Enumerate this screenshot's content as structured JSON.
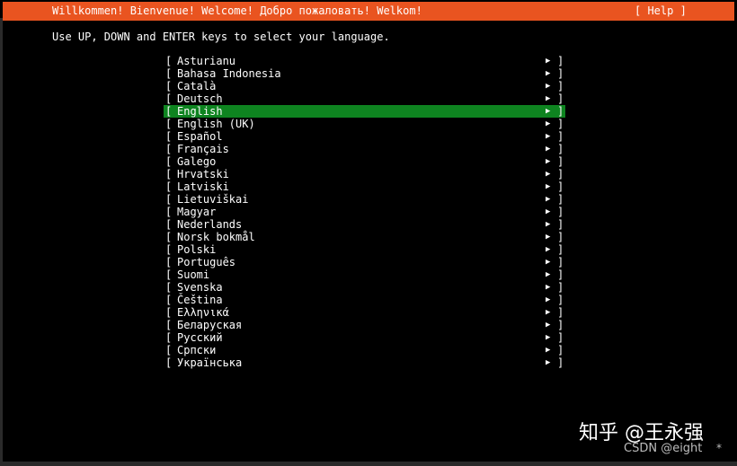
{
  "header": {
    "title": "Willkommen! Bienvenue! Welcome! Добро пожаловать! Welkom!",
    "help_label": "[ Help ]"
  },
  "instructions": "Use UP, DOWN and ENTER keys to select your language.",
  "languages": {
    "selected": "English",
    "items": [
      "Asturianu",
      "Bahasa Indonesia",
      "Català",
      "Deutsch",
      "English",
      "English (UK)",
      "Español",
      "Français",
      "Galego",
      "Hrvatski",
      "Latviski",
      "Lietuviškai",
      "Magyar",
      "Nederlands",
      "Norsk bokmål",
      "Polski",
      "Português",
      "Suomi",
      "Svenska",
      "Čeština",
      "Ελληνικά",
      "Беларуская",
      "Русский",
      "Српски",
      "Українська"
    ],
    "bracket_open": "[",
    "bracket_close": "]",
    "arrow": "▶"
  },
  "colors": {
    "header_bg": "#e95420",
    "selected_bg": "#0e8420",
    "background": "#000000",
    "text": "#ffffff"
  },
  "watermark": {
    "zhihu": "知乎 @王永强",
    "csdn": "CSDN @eight",
    "star": "*"
  }
}
